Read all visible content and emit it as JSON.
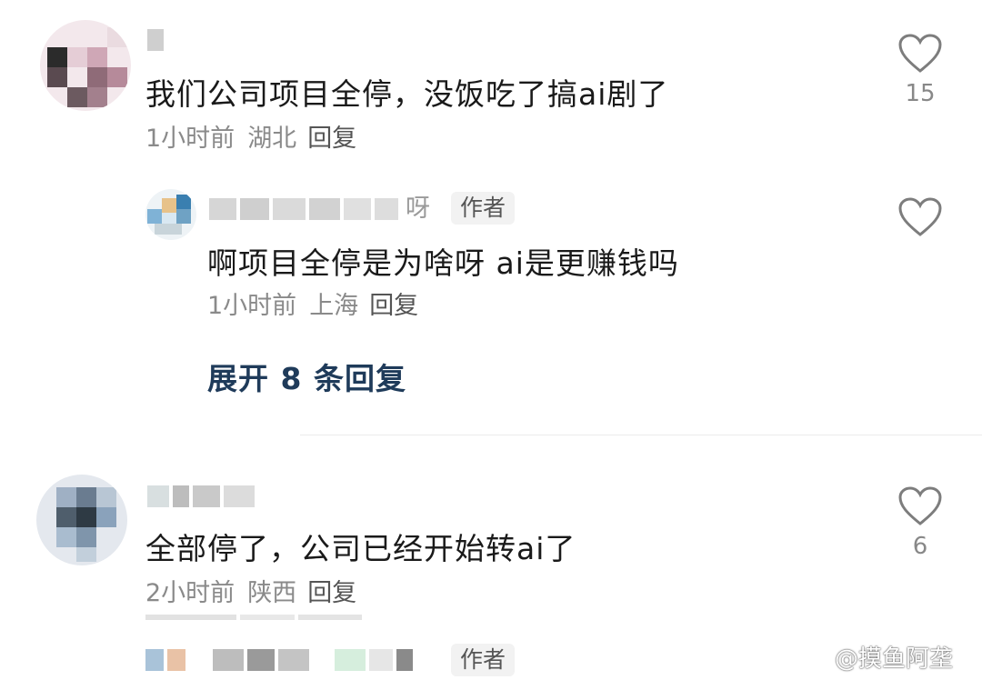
{
  "comments": [
    {
      "text": "我们公司项目全停，没饭吃了搞ai剧了",
      "time": "1小时前",
      "location": "湖北",
      "reply_label": "回复",
      "likes": "15"
    },
    {
      "text": "全部停了，公司已经开始转ai了",
      "time": "2小时前",
      "location": "陕西",
      "reply_label": "回复",
      "likes": "6"
    }
  ],
  "replies": [
    {
      "name_tail": "呀",
      "badge": "作者",
      "text": "啊项目全停是为啥呀 ai是更赚钱吗",
      "time": "1小时前",
      "location": "上海",
      "reply_label": "回复"
    }
  ],
  "expand_label": "展开 8 条回复",
  "bottom_reply_badge": "作者",
  "watermark": "@摸鱼阿垄",
  "icons": {
    "like": "heart-outline-icon"
  },
  "colors": {
    "meta_gray": "#8a8a8a",
    "expand_link": "#1f3b5a"
  }
}
